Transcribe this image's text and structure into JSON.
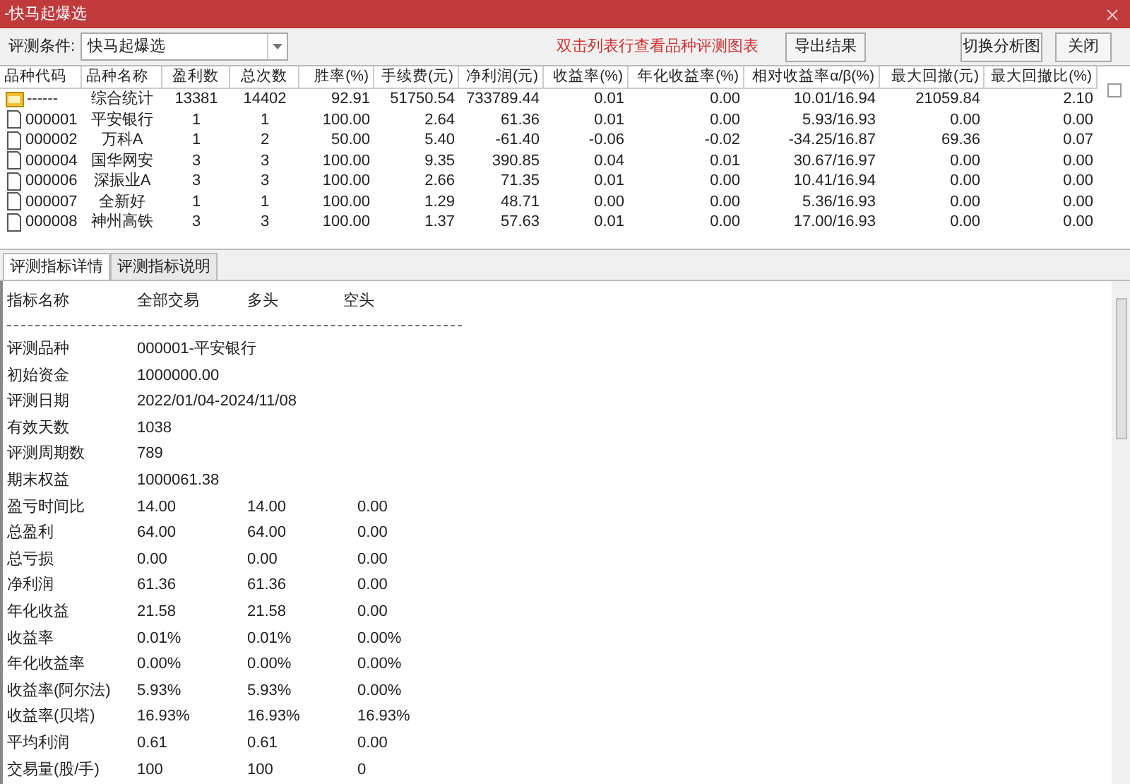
{
  "window": {
    "title": "-快马起爆选"
  },
  "toolbar": {
    "condition_label": "评测条件:",
    "condition_value": "快马起爆选",
    "hint": "双击列表行查看品种评测图表",
    "buttons": [
      {
        "label": "导出结果"
      },
      {
        "label": "切换分析图"
      },
      {
        "label": "关闭"
      }
    ]
  },
  "table": {
    "select_all": {
      "checked": false
    },
    "columns": [
      "品种代码",
      "品种名称",
      "盈利数",
      "总次数",
      "胜率(%)",
      "手续费(元)",
      "净利润(元)",
      "收益率(%)",
      "年化收益率(%)",
      "相对收益率α/β(%)",
      "最大回撤(元)",
      "最大回撤比(%)"
    ],
    "rows": [
      {
        "kind": "summary",
        "cells": [
          "------",
          "综合统计",
          "13381",
          "14402",
          "92.91",
          "51750.54",
          "733789.44",
          "0.01",
          "0.00",
          "10.01/16.94",
          "21059.84",
          "2.10"
        ]
      },
      {
        "kind": "item",
        "cells": [
          "000001",
          "平安银行",
          "1",
          "1",
          "100.00",
          "2.64",
          "61.36",
          "0.01",
          "0.00",
          "5.93/16.93",
          "0.00",
          "0.00"
        ]
      },
      {
        "kind": "item",
        "cells": [
          "000002",
          "万科A",
          "1",
          "2",
          "50.00",
          "5.40",
          "-61.40",
          "-0.06",
          "-0.02",
          "-34.25/16.87",
          "69.36",
          "0.07"
        ]
      },
      {
        "kind": "item",
        "cells": [
          "000004",
          "国华网安",
          "3",
          "3",
          "100.00",
          "9.35",
          "390.85",
          "0.04",
          "0.01",
          "30.67/16.97",
          "0.00",
          "0.00"
        ]
      },
      {
        "kind": "item",
        "cells": [
          "000006",
          "深振业A",
          "3",
          "3",
          "100.00",
          "2.66",
          "71.35",
          "0.01",
          "0.00",
          "10.41/16.94",
          "0.00",
          "0.00"
        ]
      },
      {
        "kind": "item",
        "cells": [
          "000007",
          "全新好",
          "1",
          "1",
          "100.00",
          "1.29",
          "48.71",
          "0.00",
          "0.00",
          "5.36/16.93",
          "0.00",
          "0.00"
        ]
      },
      {
        "kind": "item",
        "cells": [
          "000008",
          "神州高铁",
          "3",
          "3",
          "100.00",
          "1.37",
          "57.63",
          "0.01",
          "0.00",
          "17.00/16.93",
          "0.00",
          "0.00"
        ]
      }
    ]
  },
  "tabs": [
    {
      "label": "评测指标详情",
      "selected": true
    },
    {
      "label": "评测指标说明",
      "selected": false
    }
  ],
  "details": {
    "header": [
      "指标名称",
      "全部交易",
      "多头",
      "空头"
    ],
    "rows": [
      {
        "label": "评测品种",
        "values": [
          "000001-平安银行"
        ]
      },
      {
        "label": "初始资金",
        "values": [
          "1000000.00"
        ]
      },
      {
        "label": "评测日期",
        "values": [
          "2022/01/04-2024/11/08"
        ]
      },
      {
        "label": "有效天数",
        "values": [
          "1038"
        ]
      },
      {
        "label": "评测周期数",
        "values": [
          "789"
        ]
      },
      {
        "label": "期末权益",
        "values": [
          "1000061.38"
        ]
      },
      {
        "label": "盈亏时间比",
        "values": [
          "14.00",
          "14.00",
          "0.00"
        ]
      },
      {
        "label": "总盈利",
        "values": [
          "64.00",
          "64.00",
          "0.00"
        ]
      },
      {
        "label": "总亏损",
        "values": [
          "0.00",
          "0.00",
          "0.00"
        ]
      },
      {
        "label": "净利润",
        "values": [
          "61.36",
          "61.36",
          "0.00"
        ]
      },
      {
        "label": "年化收益",
        "values": [
          "21.58",
          "21.58",
          "0.00"
        ]
      },
      {
        "label": "收益率",
        "values": [
          "0.01%",
          "0.01%",
          "0.00%"
        ]
      },
      {
        "label": "年化收益率",
        "values": [
          "0.00%",
          "0.00%",
          "0.00%"
        ]
      },
      {
        "label": "收益率(阿尔法)",
        "values": [
          "5.93%",
          "5.93%",
          "0.00%"
        ]
      },
      {
        "label": "收益率(贝塔)",
        "values": [
          "16.93%",
          "16.93%",
          "16.93%"
        ]
      },
      {
        "label": "平均利润",
        "values": [
          "0.61",
          "0.61",
          "0.00"
        ]
      },
      {
        "label": "交易量(股/手)",
        "values": [
          "100",
          "100",
          "0"
        ]
      }
    ]
  }
}
